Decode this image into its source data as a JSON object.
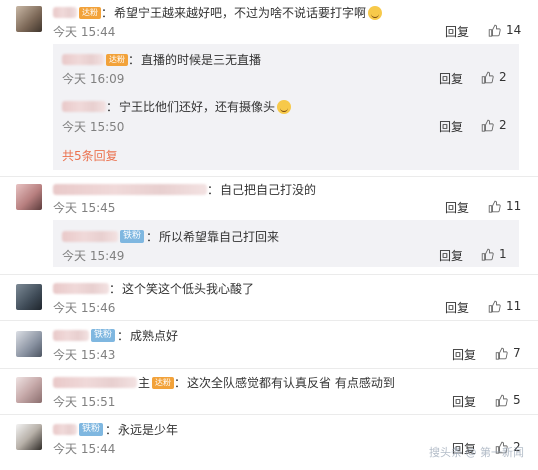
{
  "comments": [
    {
      "text": "希望宁王越来越好吧，不过为啥不说话要打字啊",
      "time": "今天 15:44",
      "reply_label": "回复",
      "likes": "14",
      "badge": "达粉",
      "sub_replies": [
        {
          "text": "直播的时候是三无直播",
          "time": "今天 16:09",
          "reply_label": "回复",
          "likes": "2",
          "badge": "达粉"
        },
        {
          "text": "宁王比他们还好，还有摄像头",
          "time": "今天 15:50",
          "reply_label": "回复",
          "likes": "2"
        }
      ],
      "more_link": "共5条回复"
    },
    {
      "text": "自己把自己打没的",
      "time": "今天 15:45",
      "reply_label": "回复",
      "likes": "11",
      "sub_replies": [
        {
          "text": "所以希望靠自己打回来",
          "time": "今天 15:49",
          "reply_label": "回复",
          "likes": "1",
          "badge": "铁粉"
        }
      ]
    },
    {
      "text": "这个笑这个低头我心酸了",
      "time": "今天 15:46",
      "reply_label": "回复",
      "likes": "11"
    },
    {
      "text": "成熟点好",
      "time": "今天 15:43",
      "reply_label": "回复",
      "likes": "7",
      "badge": "铁粉"
    },
    {
      "text": "这次全队感觉都有认真反省 有点感动到",
      "time": "今天 15:51",
      "reply_label": "回复",
      "likes": "5",
      "badge": "达粉",
      "name_suffix": "主"
    },
    {
      "text": "永远是少年",
      "time": "今天 15:44",
      "reply_label": "回复",
      "likes": "2",
      "badge": "铁粉"
    }
  ],
  "colors": {
    "link": "#eb7350",
    "subbox_bg": "#f2f2f5",
    "time": "#808080"
  },
  "icons": {
    "like": "thumb-up-icon"
  },
  "watermark": "搜头条 @ 第一新闻"
}
